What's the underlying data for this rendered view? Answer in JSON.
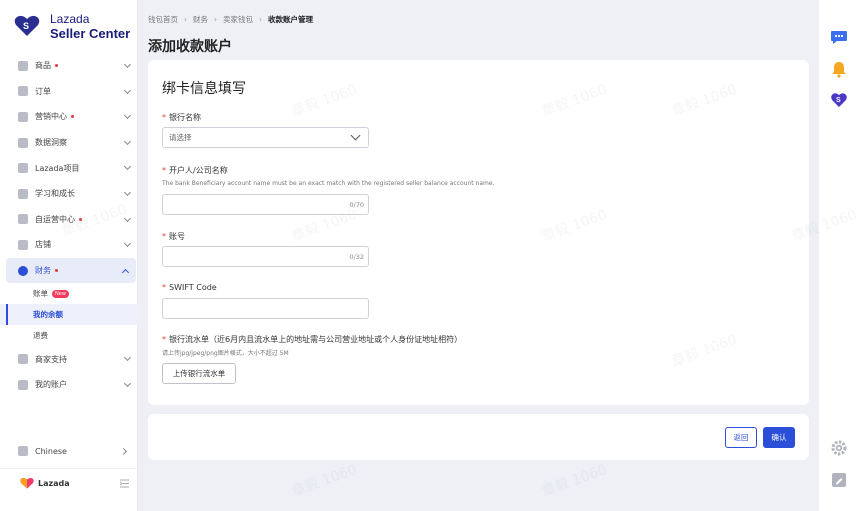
{
  "brand": {
    "name_line1": "Lazada",
    "name_line2": "Seller Center",
    "bottom_name": "Lazada",
    "accent": "#2b4fd8"
  },
  "sidebar": {
    "items": [
      {
        "label": "商品",
        "icon": "box-icon",
        "dot": true
      },
      {
        "label": "订单",
        "icon": "order-icon",
        "dot": false
      },
      {
        "label": "营销中心",
        "icon": "marketing-icon",
        "dot": true
      },
      {
        "label": "数据洞察",
        "icon": "data-icon",
        "dot": false
      },
      {
        "label": "Lazada项目",
        "icon": "project-icon",
        "dot": false
      },
      {
        "label": "学习和成长",
        "icon": "learn-icon",
        "dot": false
      },
      {
        "label": "自运营中心",
        "icon": "self-op-icon",
        "dot": true
      },
      {
        "label": "店铺",
        "icon": "store-icon",
        "dot": false
      },
      {
        "label": "财务",
        "icon": "finance-icon",
        "dot": true
      }
    ],
    "finance_sub": [
      {
        "label": "账单",
        "badge": "New"
      },
      {
        "label": "我的余额",
        "badge": ""
      },
      {
        "label": "退费",
        "badge": ""
      }
    ],
    "items_after": [
      {
        "label": "商家支持",
        "icon": "support-icon"
      },
      {
        "label": "我的账户",
        "icon": "account-icon"
      }
    ],
    "language": "Chinese"
  },
  "breadcrumb": {
    "items": [
      "钱包首页",
      "财务",
      "卖家钱包"
    ],
    "current": "收款账户管理"
  },
  "page": {
    "title": "添加收款账户"
  },
  "form": {
    "title": "绑卡信息填写",
    "bank_name": {
      "label": "银行名称",
      "placeholder": "请选择"
    },
    "account_holder": {
      "label": "开户人/公司名称",
      "hint": "The bank Beneficiary account name must be an exact match with the registered seller balance account name.",
      "value": "",
      "counter": "0/70"
    },
    "account_number": {
      "label": "账号",
      "value": "",
      "counter": "0/32"
    },
    "swift": {
      "label": "SWIFT Code",
      "value": ""
    },
    "statement": {
      "label": "银行流水单（近6月内且流水单上的地址需与公司营业地址或个人身份证地址相符）",
      "hint": "请上传jpg/jpeg/png图片格式，大小不超过 5M",
      "upload_label": "上传银行流水单"
    }
  },
  "footer": {
    "back_label": "返回",
    "confirm_label": "确认"
  },
  "watermark": "章毅 1060"
}
